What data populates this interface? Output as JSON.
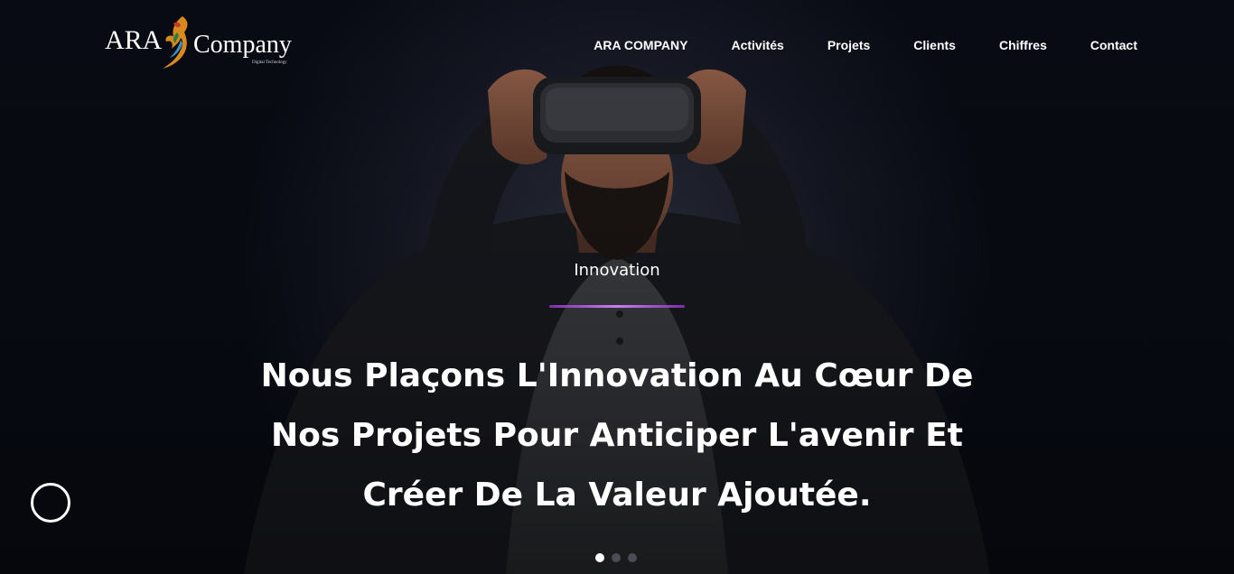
{
  "header": {
    "logo": {
      "ara": "ARA",
      "company": "Company",
      "tagline": "Digital Technology"
    },
    "nav": [
      {
        "label": "ARA COMPANY"
      },
      {
        "label": "Activités"
      },
      {
        "label": "Projets"
      },
      {
        "label": "Clients"
      },
      {
        "label": "Chiffres"
      },
      {
        "label": "Contact"
      }
    ]
  },
  "hero": {
    "eyebrow": "Innovation",
    "headline_lines": [
      "Nous Plaçons L'Innovation Au Cœur De",
      "Nos Projets Pour Anticiper L'avenir Et",
      "Créer De La Valeur Ajoutée."
    ],
    "slider": {
      "total": 3,
      "active": 1
    }
  },
  "colors": {
    "background": "#080b13",
    "accent": "#9b4dcf",
    "text": "#ffffff"
  },
  "icons": {
    "logo_bird": "phoenix-bird-icon",
    "circle_button": "circle-icon"
  }
}
